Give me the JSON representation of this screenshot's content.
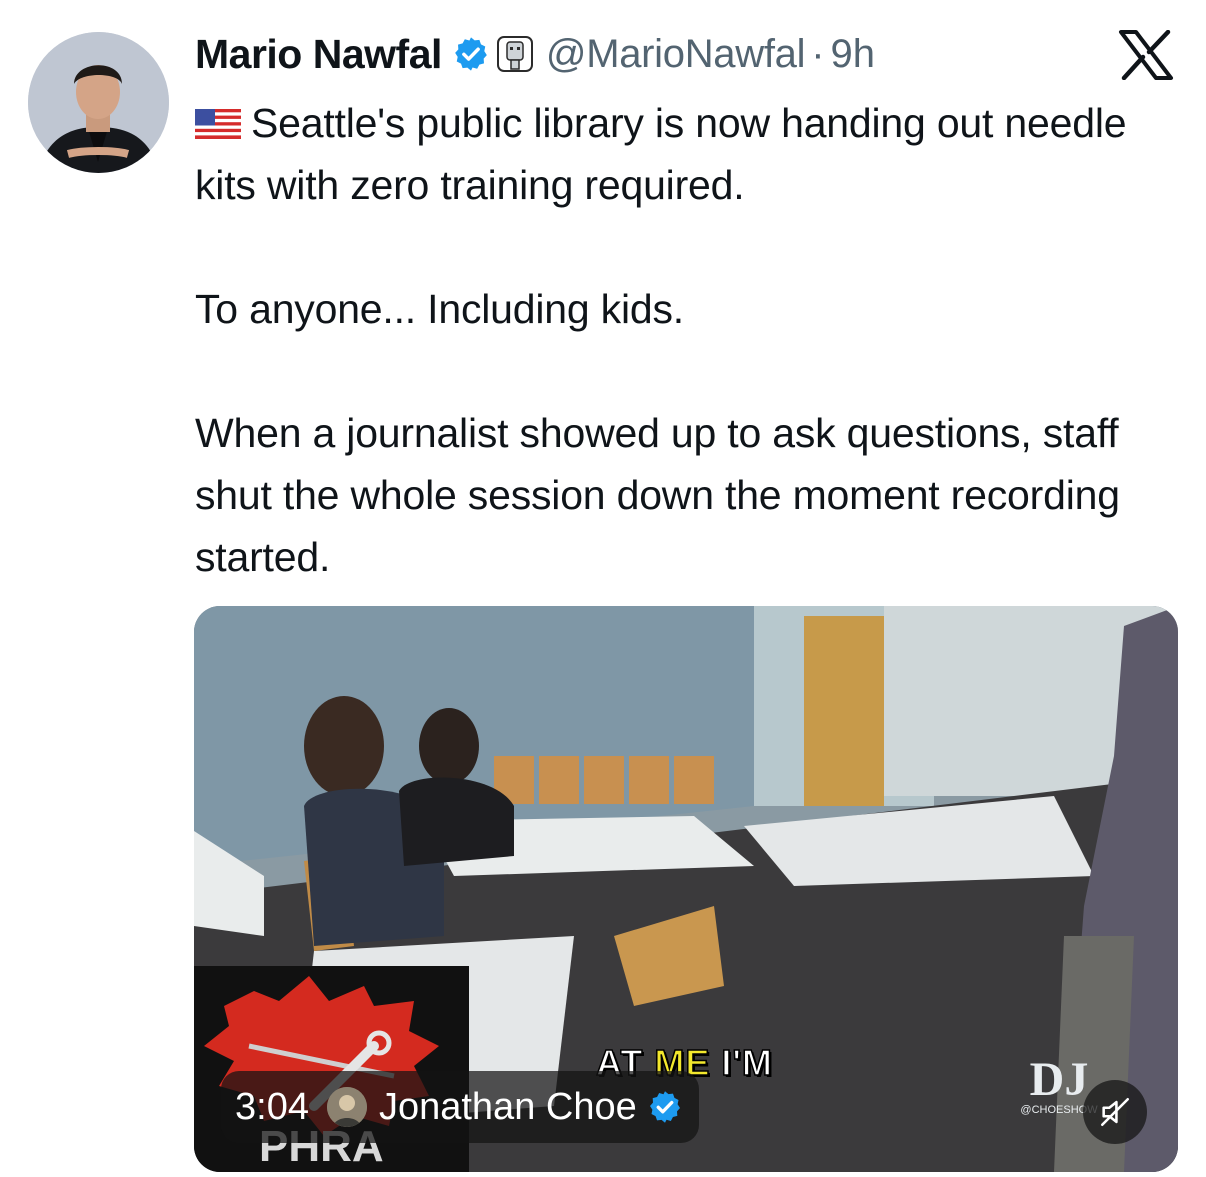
{
  "author": {
    "display_name": "Mario Nawfal",
    "handle": "@MarioNawfal",
    "separator": "·",
    "time": "9h",
    "avatar_icon": "person-avatar",
    "verified_icon": "verified-badge-icon",
    "affiliate_icon": "affiliate-badge-icon"
  },
  "brand": {
    "logo_icon": "x-logo-icon"
  },
  "tweet": {
    "flag_icon": "us-flag-icon",
    "paragraph_1": "Seattle's public library is now handing out needle kits with zero training required.",
    "paragraph_2": "To anyone... Including kids.",
    "paragraph_3": "When a journalist showed up to ask questions, staff shut the whole session down the moment recording started."
  },
  "media": {
    "caption_white_1": "AT ",
    "caption_highlight": "ME",
    "caption_white_2": " I'M",
    "logo_text": "PHRA",
    "duration": "3:04",
    "source_name": "Jonathan Choe",
    "watermark_main": "DJ",
    "watermark_sub": "@CHOESHOW",
    "mute_icon": "muted-speaker-icon"
  },
  "colors": {
    "text": "#0f1419",
    "secondary": "#536471",
    "verified_blue": "#1d9bf0",
    "caption_yellow": "#f3e82d"
  }
}
